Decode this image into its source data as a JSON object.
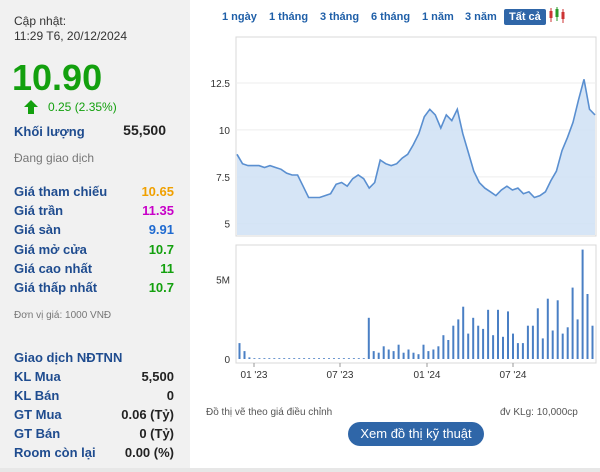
{
  "header": {
    "update_label": "Cập nhật:",
    "update_time": "11:29 T6, 20/12/2024"
  },
  "quote": {
    "price": "10.90",
    "change": "0.25 (2.35%)",
    "volume_label": "Khối lượng",
    "volume_value": "55,500",
    "status": "Đang giao dịch",
    "up_color": "#13a00e"
  },
  "price_rows": [
    {
      "label": "Giá tham chiếu",
      "value": "10.65",
      "color": "#f0a000"
    },
    {
      "label": "Giá trần",
      "value": "11.35",
      "color": "#c800c8"
    },
    {
      "label": "Giá sàn",
      "value": "9.91",
      "color": "#1f6ad0"
    },
    {
      "label": "Giá mở cửa",
      "value": "10.7",
      "color": "#13a00e"
    },
    {
      "label": "Giá cao nhất",
      "value": "11",
      "color": "#13a00e"
    },
    {
      "label": "Giá thấp nhất",
      "value": "10.7",
      "color": "#13a00e"
    }
  ],
  "unit_note": "Đơn vị giá: 1000 VNĐ",
  "foreign": {
    "title": "Giao dịch NĐTNN",
    "rows": [
      {
        "label": "KL Mua",
        "value": "5,500"
      },
      {
        "label": "KL Bán",
        "value": "0"
      },
      {
        "label": "GT Mua",
        "value": "0.06 (Tỷ)"
      },
      {
        "label": "GT Bán",
        "value": "0 (Tỷ)"
      },
      {
        "label": "Room còn lại",
        "value": "0.00 (%)"
      }
    ]
  },
  "tabs": [
    "1 ngày",
    "1 tháng",
    "3 tháng",
    "6 tháng",
    "1 năm",
    "3 năm",
    "Tất cả"
  ],
  "active_tab": "Tất cả",
  "chart_data": {
    "type": "area",
    "price_y_ticks": [
      "12.5",
      "10",
      "7.5",
      "5"
    ],
    "price_ylim": [
      4.4,
      14.9
    ],
    "volume_y_ticks": [
      "5M",
      "0"
    ],
    "x_ticks": [
      "01 '23",
      "07 '23",
      "01 '24",
      "07 '24"
    ],
    "price_series": [
      8.7,
      8.2,
      8.1,
      8.1,
      8.1,
      8.0,
      8.1,
      8.0,
      7.9,
      7.7,
      7.6,
      7.6,
      7.0,
      6.4,
      6.4,
      6.4,
      6.5,
      6.6,
      7.1,
      7.2,
      7.0,
      7.4,
      7.6,
      7.4,
      6.9,
      7.2,
      8.4,
      8.2,
      8.1,
      8.2,
      8.5,
      8.7,
      9.2,
      9.8,
      10.7,
      11.1,
      10.8,
      10.1,
      10.8,
      10.5,
      11.1,
      9.8,
      8.8,
      7.8,
      7.2,
      6.9,
      6.7,
      6.5,
      6.8,
      7.0,
      6.8,
      6.9,
      6.6,
      6.7,
      6.4,
      6.5,
      6.7,
      7.3,
      7.8,
      8.9,
      9.6,
      10.4,
      11.6,
      12.7,
      11.1,
      10.8
    ],
    "volume_series": [
      1.0,
      0.5,
      0.1,
      0.05,
      0.05,
      0.05,
      0.05,
      0.05,
      0.05,
      0.05,
      0.05,
      0.05,
      0.05,
      0.05,
      0.05,
      0.05,
      0.05,
      0.05,
      0.05,
      0.05,
      0.05,
      0.05,
      0.05,
      0.05,
      0.05,
      0.05,
      2.6,
      0.5,
      0.4,
      0.8,
      0.6,
      0.5,
      0.9,
      0.4,
      0.6,
      0.4,
      0.3,
      0.9,
      0.5,
      0.6,
      0.8,
      1.5,
      1.2,
      2.1,
      2.5,
      3.3,
      1.6,
      2.6,
      2.1,
      1.9,
      3.1,
      1.5,
      3.1,
      1.4,
      3.0,
      1.6,
      1.0,
      1.0,
      2.1,
      2.1,
      3.2,
      1.3,
      3.8,
      1.8,
      3.7,
      1.6,
      2.0,
      4.5,
      2.5,
      6.9,
      4.1,
      2.1
    ],
    "line_color": "#5a8fd0",
    "fill_color": "#cfe1f5"
  },
  "footer": {
    "adjusted_note": "Đồ thị vẽ theo giá điều chỉnh",
    "volume_unit": "đv KLg: 10,000cp",
    "tech_button": "Xem đồ thị kỹ thuật"
  }
}
